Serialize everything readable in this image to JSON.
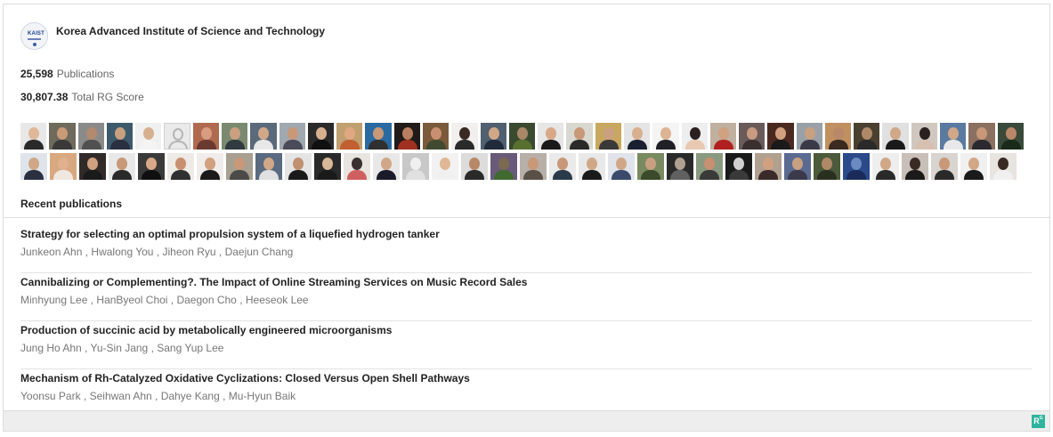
{
  "institution": {
    "name": "Korea Advanced Institute of Science and Technology",
    "logo_text": "KAIST"
  },
  "stats": {
    "publications_value": "25,598",
    "publications_label": "Publications",
    "rg_score_value": "30,807.38",
    "rg_score_label": "Total RG Score"
  },
  "recent_publications_heading": "Recent publications",
  "publications": [
    {
      "title": "Strategy for selecting an optimal propulsion system of a liquefied hydrogen tanker",
      "authors": [
        "Junkeon Ahn",
        "Hwalong You",
        "Jiheon Ryu",
        "Daejun Chang"
      ]
    },
    {
      "title": "Cannibalizing or Complementing?. The Impact of Online Streaming Services on Music Record Sales",
      "authors": [
        "Minhyung Lee",
        "HanByeol Choi",
        "Daegon Cho",
        "Heeseok Lee"
      ]
    },
    {
      "title": "Production of succinic acid by metabolically engineered microorganisms",
      "authors": [
        "Jung Ho Ahn",
        "Yu-Sin Jang",
        "Sang Yup Lee"
      ]
    },
    {
      "title": "Mechanism of Rh-Catalyzed Oxidative Cyclizations: Closed Versus Open Shell Pathways",
      "authors": [
        "Yoonsu Park",
        "Seihwan Ahn",
        "Dahye Kang",
        "Mu-Hyun Baik"
      ]
    }
  ],
  "footer": {
    "badge_text": "R",
    "badge_sup": "G",
    "badge_color": "#2fb59d"
  },
  "avatar_rows": [
    [
      {
        "bg": "#e8e8e8",
        "head": "#e0b898",
        "body": "#2a2a2a"
      },
      {
        "bg": "#6e6a5c",
        "head": "#c89a78",
        "body": "#3a3a3a"
      },
      {
        "bg": "#8a8a8a",
        "head": "#b28a70",
        "body": "#505050"
      },
      {
        "bg": "#3d5a6c",
        "head": "#c8a080",
        "body": "#2a3040"
      },
      {
        "bg": "#f0f0f0",
        "head": "#d8b090",
        "body": "#f4f4f4"
      },
      {
        "placeholder": true
      },
      {
        "bg": "#b06a50",
        "head": "#d89c80",
        "body": "#6a3a30"
      },
      {
        "bg": "#7a8a70",
        "head": "#caa080",
        "body": "#303a40"
      },
      {
        "bg": "#5a6a7a",
        "head": "#d0a888",
        "body": "#e8e8e8"
      },
      {
        "bg": "#a0a8b0",
        "head": "#c89878",
        "body": "#4a4a58"
      },
      {
        "bg": "#2a2a2a",
        "head": "#d8b090",
        "body": "#101010"
      },
      {
        "bg": "#c0a070",
        "head": "#e0a880",
        "body": "#c06030"
      },
      {
        "bg": "#2a6aa0",
        "head": "#c89878",
        "body": "#303030"
      },
      {
        "bg": "#201a18",
        "head": "#b88060",
        "body": "#a03020"
      },
      {
        "bg": "#7a5a3a",
        "head": "#c89070",
        "body": "#404a30"
      },
      {
        "bg": "#f2f0ee",
        "head": "#3a2a24",
        "body": "#2a2a2a"
      },
      {
        "bg": "#506070",
        "head": "#d0a888",
        "body": "#202a3a"
      },
      {
        "bg": "#3a4a30",
        "head": "#a88868",
        "body": "#5a7030"
      },
      {
        "bg": "#e6e6e6",
        "head": "#d8a888",
        "body": "#1a1a1a"
      },
      {
        "bg": "#d8d8d0",
        "head": "#c89878",
        "body": "#2a2a2a"
      },
      {
        "bg": "#c8a860",
        "head": "#caa080",
        "body": "#3a3a3a"
      },
      {
        "bg": "#e4e4e4",
        "head": "#d8b090",
        "body": "#1a2030"
      },
      {
        "bg": "#f4f4f4",
        "head": "#dcb494",
        "body": "#202028"
      },
      {
        "bg": "#eeeeee",
        "head": "#2a2020",
        "body": "#e8c8b0"
      },
      {
        "bg": "#c0b0a0",
        "head": "#d0a080",
        "body": "#b02020"
      },
      {
        "bg": "#6a5a5a",
        "head": "#c89a80",
        "body": "#3a3030"
      },
      {
        "bg": "#4a2a20",
        "head": "#d0a080",
        "body": "#1a1a1a"
      },
      {
        "bg": "#9aa0a8",
        "head": "#c8a080",
        "body": "#3a3a48"
      },
      {
        "bg": "#c09060",
        "head": "#b88868",
        "body": "#3a2a20"
      },
      {
        "bg": "#4a4030",
        "head": "#b08868",
        "body": "#2a2a2a"
      },
      {
        "bg": "#e0e0e0",
        "head": "#d0a888",
        "body": "#1a1a1a"
      },
      {
        "bg": "#d0c8c0",
        "head": "#2a2020",
        "body": "#d8c0b0"
      },
      {
        "bg": "#5a7aa0",
        "head": "#d0a888",
        "body": "#e8e8ea"
      },
      {
        "bg": "#8a7060",
        "head": "#c89878",
        "body": "#2a2a30"
      },
      {
        "bg": "#3a4a3a",
        "head": "#b88868",
        "body": "#1a2a1a"
      }
    ],
    [
      {
        "bg": "#dfe4ea",
        "head": "#d0a888",
        "body": "#2a3040"
      },
      {
        "bg": "#d8a880",
        "head": "#e0b090",
        "body": "#f0e8e0"
      },
      {
        "bg": "#302a28",
        "head": "#d0a080",
        "body": "#1a1a1a"
      },
      {
        "bg": "#e8e8e8",
        "head": "#c89878",
        "body": "#2a2a2a"
      },
      {
        "bg": "#3a3a3a",
        "head": "#d8a888",
        "body": "#101010"
      },
      {
        "bg": "#eeeae6",
        "head": "#c89070",
        "body": "#303030"
      },
      {
        "bg": "#f0ecea",
        "head": "#d0a080",
        "body": "#1a1a1a"
      },
      {
        "bg": "#a8a090",
        "head": "#c89878",
        "body": "#4a4a48"
      },
      {
        "bg": "#5a6a80",
        "head": "#d0a888",
        "body": "#e0e0e0"
      },
      {
        "bg": "#e4e4e4",
        "head": "#c09070",
        "body": "#1a1a1a"
      },
      {
        "bg": "#2a2a2a",
        "head": "#d8b898",
        "body": "#1a1a1a"
      },
      {
        "bg": "#e8e4e0",
        "head": "#3a3030",
        "body": "#d06060"
      },
      {
        "bg": "#e8e8e8",
        "head": "#d0a888",
        "body": "#1a1a2a"
      },
      {
        "bg": "#c8c8c8",
        "head": "#f0f0f0",
        "body": "#e0e0e0"
      },
      {
        "bg": "#f2f2f2",
        "head": "#e0b898",
        "body": "#f0f0f0"
      },
      {
        "bg": "#dcdcdc",
        "head": "#b88868",
        "body": "#2a2a2a"
      },
      {
        "bg": "#6a5a7a",
        "head": "#7a6a50",
        "body": "#406a30"
      },
      {
        "bg": "#b8b0a8",
        "head": "#c89878",
        "body": "#5a5048"
      },
      {
        "bg": "#eaeaea",
        "head": "#c89878",
        "body": "#2a3a4a"
      },
      {
        "bg": "#e8e8e8",
        "head": "#d0a888",
        "body": "#1a1a1a"
      },
      {
        "bg": "#e0e4ea",
        "head": "#d0a888",
        "body": "#3a4a6a"
      },
      {
        "bg": "#7a8a60",
        "head": "#c8a080",
        "body": "#3a4a2a"
      },
      {
        "bg": "#2a2a2a",
        "head": "#b0a090",
        "body": "#606060"
      },
      {
        "bg": "#8a9a80",
        "head": "#c89070",
        "body": "#3a3a3a"
      },
      {
        "bg": "#1a1a1a",
        "head": "#d0d0d0",
        "body": "#3a3a3a"
      },
      {
        "bg": "#b0a090",
        "head": "#d0a080",
        "body": "#3a2a2a"
      },
      {
        "bg": "#5a6a90",
        "head": "#c8a080",
        "body": "#3a3a4a"
      },
      {
        "bg": "#4a5a3a",
        "head": "#b08868",
        "body": "#2a3020"
      },
      {
        "bg": "#2a4a8a",
        "head": "#6a8ac0",
        "body": "#1a2a5a"
      },
      {
        "bg": "#eeeeee",
        "head": "#d0a888",
        "body": "#2a2a2a"
      },
      {
        "bg": "#c8c0b8",
        "head": "#3a2a24",
        "body": "#1a1a1a"
      },
      {
        "bg": "#d8d4d0",
        "head": "#c89878",
        "body": "#2a2a2a"
      },
      {
        "bg": "#f0f0f0",
        "head": "#d0a888",
        "body": "#1a1a1a"
      },
      {
        "bg": "#e8e4e0",
        "head": "#3a2a24",
        "body": "#f0f0f0"
      }
    ]
  ]
}
